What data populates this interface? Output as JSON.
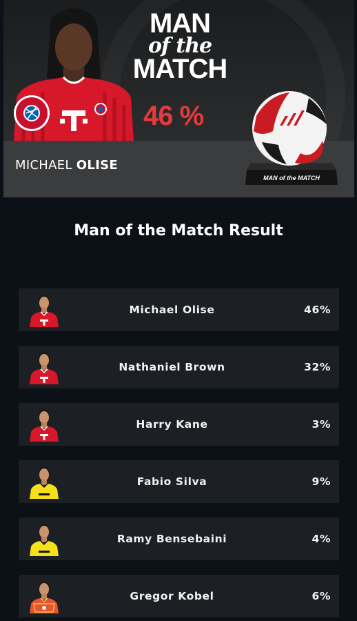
{
  "hero": {
    "title_line1": "MAN",
    "title_line2": "of the",
    "title_line3": "MATCH",
    "percent": "46 %",
    "player_first": "MICHAEL",
    "player_last": "OLISE",
    "trophy_label": "MAN of the MATCH",
    "club_badge_text": "FC BAYERN MÜNCHEN"
  },
  "result": {
    "title": "Man of the Match Result",
    "rows": [
      {
        "name": "Michael Olise",
        "percent": "46%",
        "kit": "bayern"
      },
      {
        "name": "Nathaniel Brown",
        "percent": "32%",
        "kit": "bayern"
      },
      {
        "name": "Harry Kane",
        "percent": "3%",
        "kit": "bayern"
      },
      {
        "name": "Fabio Silva",
        "percent": "9%",
        "kit": "dortmund"
      },
      {
        "name": "Ramy Bensebaini",
        "percent": "4%",
        "kit": "dortmund"
      },
      {
        "name": "Gregor Kobel",
        "percent": "6%",
        "kit": "keeper"
      }
    ]
  },
  "colors": {
    "page_bg": "#0b1116",
    "row_bg": "#1c1f24",
    "accent_red": "#e53b3b",
    "bayern_red": "#d6182a",
    "dortmund_yellow": "#f5e11a"
  }
}
